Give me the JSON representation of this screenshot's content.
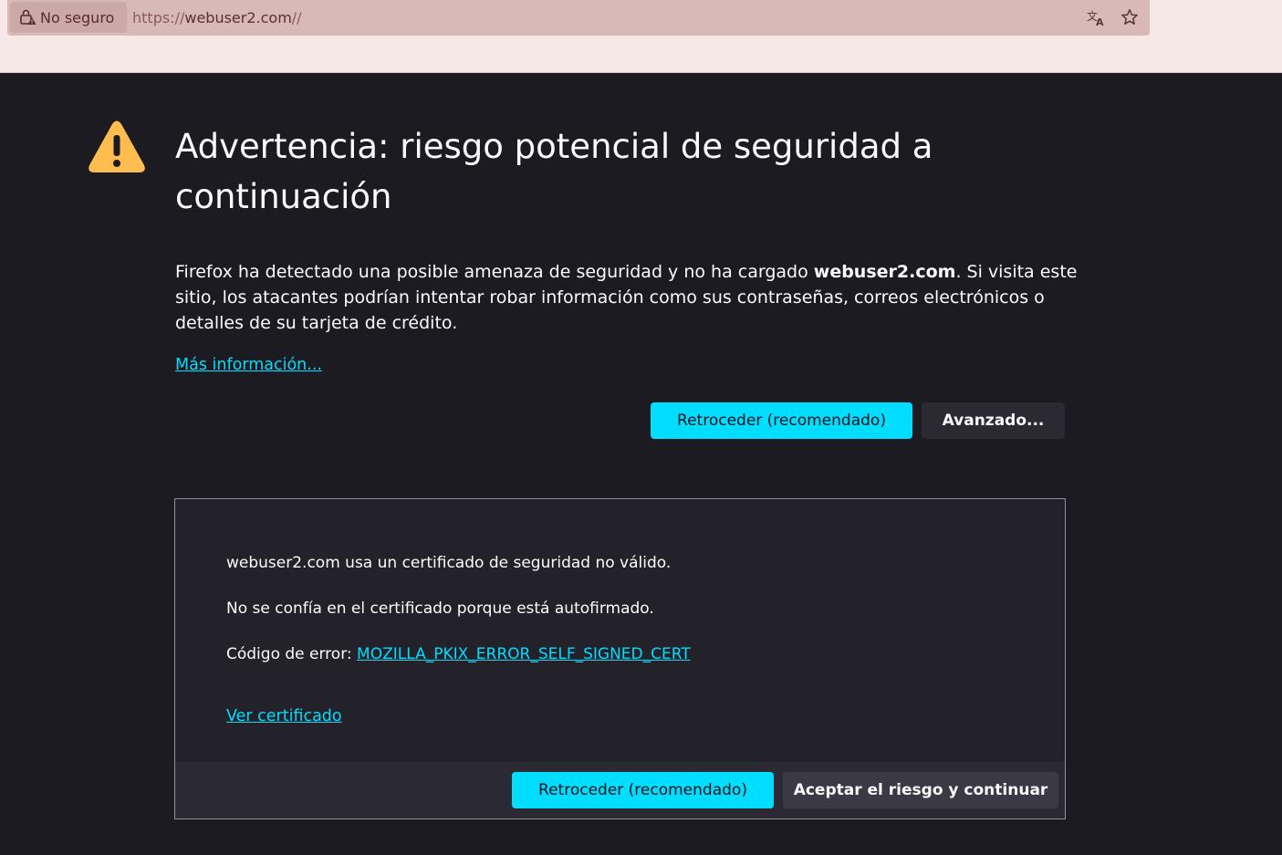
{
  "browser": {
    "security_label": "No seguro",
    "url_prefix": "https://",
    "url_host": "webuser2.com",
    "url_suffix": "//",
    "icons": [
      "lock-warning-icon",
      "translate-icon",
      "star-icon"
    ]
  },
  "page": {
    "title": "Advertencia: riesgo potencial de seguridad a continuación",
    "intro_before": "Firefox ha detectado una posible amenaza de seguridad y no ha cargado ",
    "intro_host": "webuser2.com",
    "intro_after": ". Si visita este sitio, los atacantes podrían intentar robar información como sus contraseñas, correos electrónicos o detalles de su tarjeta de crédito.",
    "more_info_link": "Más información...",
    "go_back_button": "Retroceder (recomendado)",
    "advanced_button": "Avanzado...",
    "accent_color": "#00ddff",
    "warning_color": "#ffbd4f"
  },
  "advanced_panel": {
    "line1": "webuser2.com usa un certificado de seguridad no válido.",
    "line2": "No se confía en el certificado porque está autofirmado.",
    "error_label": "Código de error: ",
    "error_code": "MOZILLA_PKIX_ERROR_SELF_SIGNED_CERT",
    "view_certificate_link": "Ver certificado",
    "go_back_button": "Retroceder (recomendado)",
    "accept_button": "Aceptar el riesgo y continuar"
  }
}
